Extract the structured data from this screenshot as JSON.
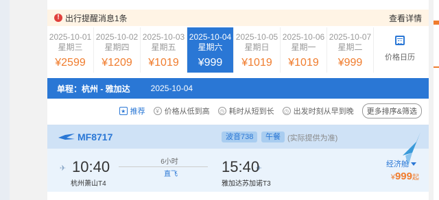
{
  "notice": {
    "text": "出行提醒消息1条",
    "link": "查看详情"
  },
  "dates": [
    {
      "date": "2025-10-01",
      "weekday": "星期三",
      "price": "¥2599",
      "active": false
    },
    {
      "date": "2025-10-02",
      "weekday": "星期四",
      "price": "¥1209",
      "active": false
    },
    {
      "date": "2025-10-03",
      "weekday": "星期五",
      "price": "¥1019",
      "active": false
    },
    {
      "date": "2025-10-04",
      "weekday": "星期六",
      "price": "¥999",
      "active": true
    },
    {
      "date": "2025-10-05",
      "weekday": "星期日",
      "price": "¥1019",
      "active": false
    },
    {
      "date": "2025-10-06",
      "weekday": "星期一",
      "price": "¥1019",
      "active": false
    },
    {
      "date": "2025-10-07",
      "weekday": "星期二",
      "price": "¥999",
      "active": false
    }
  ],
  "calendar": {
    "label": "价格日历",
    "icon": "calendar-icon"
  },
  "route": {
    "label": "单程：杭州 - 雅加达",
    "date": "2025-10-04"
  },
  "sort": {
    "recommend": "推荐",
    "price_low_high": "价格从低到高",
    "duration_short_long": "耗时从短到长",
    "departure_early_late": "出发时刻从早到晚",
    "more": "更多排序&筛选"
  },
  "flight": {
    "flight_no": "MF8717",
    "aircraft": "波音738",
    "meal": "午餐",
    "share_note": "(实际提供为准)",
    "dep_time": "10:40",
    "arr_time": "15:40",
    "dep_airport": "杭州萧山T4",
    "arr_airport": "雅加达苏加诺T3",
    "duration": "6小时",
    "stop": "直飞",
    "cabin": "经济舱",
    "currency": "¥",
    "price": "999",
    "price_suffix": "起"
  },
  "colors": {
    "accent": "#2a77d5",
    "price": "#f07c2d",
    "notice_bg": "#fff4e5",
    "alert": "#e0403c"
  }
}
